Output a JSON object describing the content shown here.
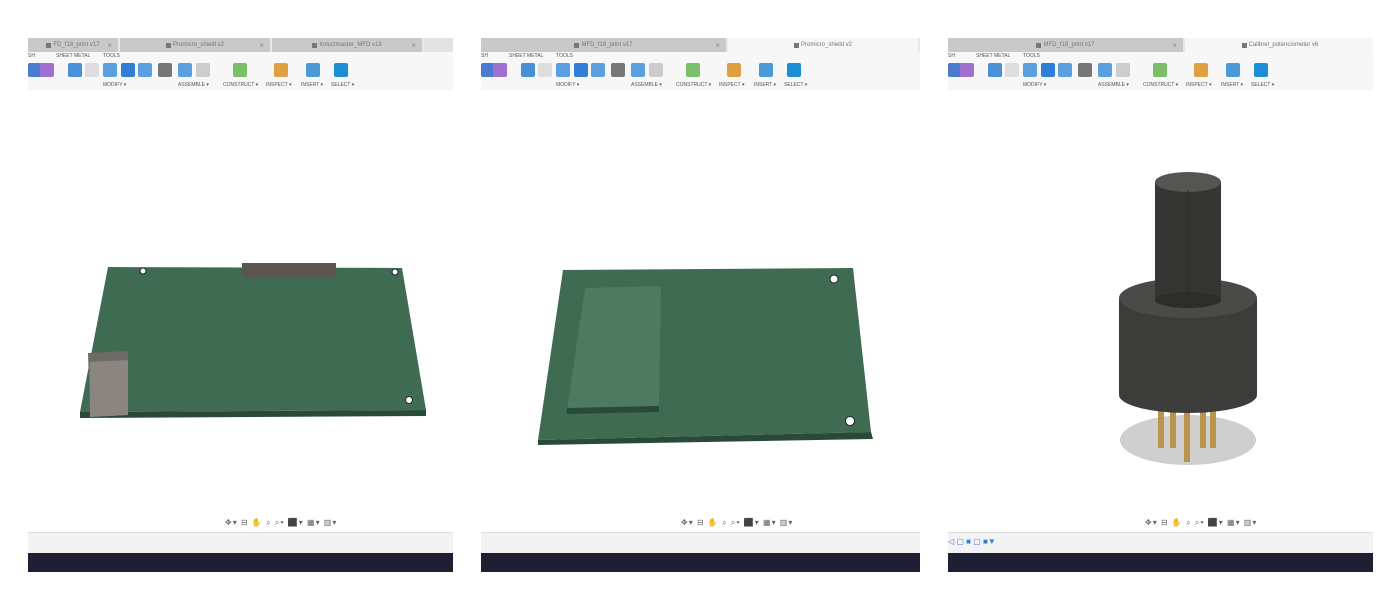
{
  "panels": [
    {
      "tabs": [
        {
          "label": "FD_f18_print v17",
          "active": false,
          "close": "×"
        },
        {
          "label": "Promicro_shield v2",
          "active": false,
          "close": "×"
        },
        {
          "label": "Inductmaster_MFD v18",
          "active": false,
          "close": "×"
        }
      ],
      "model": "pcb-with-connector"
    },
    {
      "tabs": [
        {
          "label": "MFD_f18_print v17",
          "active": false,
          "close": "×"
        },
        {
          "label": "Promicro_shield v2",
          "active": true,
          "close": ""
        }
      ],
      "model": "pcb-with-shield"
    },
    {
      "tabs": [
        {
          "label": "MFD_f18_print v17",
          "active": false,
          "close": "×"
        },
        {
          "label": "Calibrel_potenciometer v6",
          "active": true,
          "close": ""
        }
      ],
      "model": "rotary-switch"
    }
  ],
  "toolbar": {
    "groups": [
      "SH",
      "SHEET METAL",
      "TOOLS"
    ],
    "menus": [
      "MODIFY ▾",
      "ASSEMBLE ▾",
      "CONSTRUCT ▾",
      "INSPECT ▾",
      "INSERT ▾",
      "SELECT ▾"
    ]
  },
  "navbar": "✥▾ ⊟ ✋ ⌕ ⌕▾ ⬛▾ ▦▾ ▥▾",
  "timeline": "◁ ▢ ■ ▢ ■▼",
  "colors": {
    "pcb": "#3f6b52",
    "dark_bar": "#1f1f33",
    "select_blue": "#1a8fd6"
  }
}
